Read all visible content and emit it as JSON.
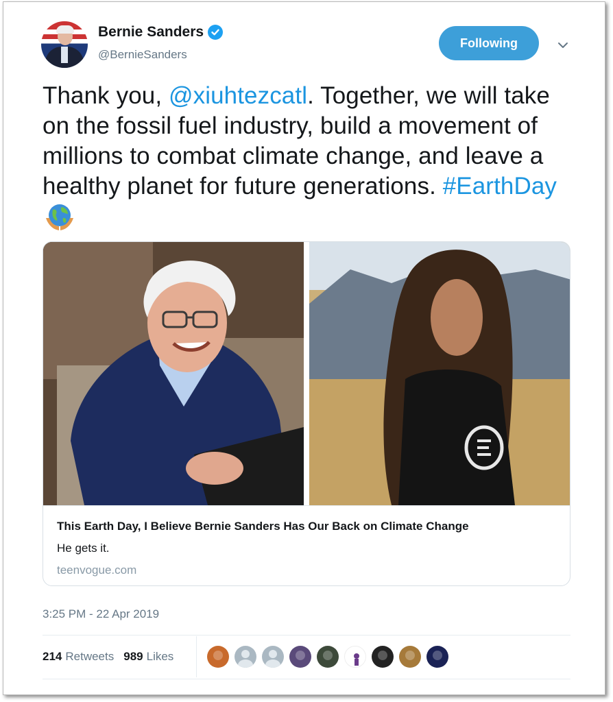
{
  "user": {
    "display_name": "Bernie Sanders",
    "handle": "@BernieSanders",
    "verified": true
  },
  "follow_button": {
    "label": "Following",
    "color": "#3d9fd9"
  },
  "tweet": {
    "text_before": "Thank you, ",
    "mention": "@xiuhtezcatl",
    "text_middle": ". Together, we will take on the fossil fuel industry, build a movement of millions to combat climate change, and leave a healthy planet for future generations. ",
    "hashtag": "#EarthDay",
    "emoji": "globe-in-hands-icon",
    "link_color": "#1b95e0"
  },
  "card": {
    "title": "This Earth Day, I Believe Bernie Sanders Has Our Back on Climate Change",
    "description": "He gets it.",
    "domain": "teenvogue.com"
  },
  "timestamp": "3:25 PM - 22 Apr 2019",
  "stats": {
    "retweets_count": "214",
    "retweets_label": "Retweets",
    "likes_count": "989",
    "likes_label": "Likes"
  },
  "likers": [
    {
      "icon": "fox-avatar",
      "color": "#c86a2c"
    },
    {
      "icon": "default-avatar",
      "color": "#aab8c2"
    },
    {
      "icon": "default-avatar",
      "color": "#aab8c2"
    },
    {
      "icon": "person-avatar",
      "color": "#5a4a7a"
    },
    {
      "icon": "truck-avatar",
      "color": "#3d4a3a"
    },
    {
      "icon": "figure-avatar",
      "color": "#ffffff"
    },
    {
      "icon": "fist-avatar",
      "color": "#222222"
    },
    {
      "icon": "costume-avatar",
      "color": "#a67a3a"
    },
    {
      "icon": "night-sky-avatar",
      "color": "#1a2255"
    }
  ]
}
